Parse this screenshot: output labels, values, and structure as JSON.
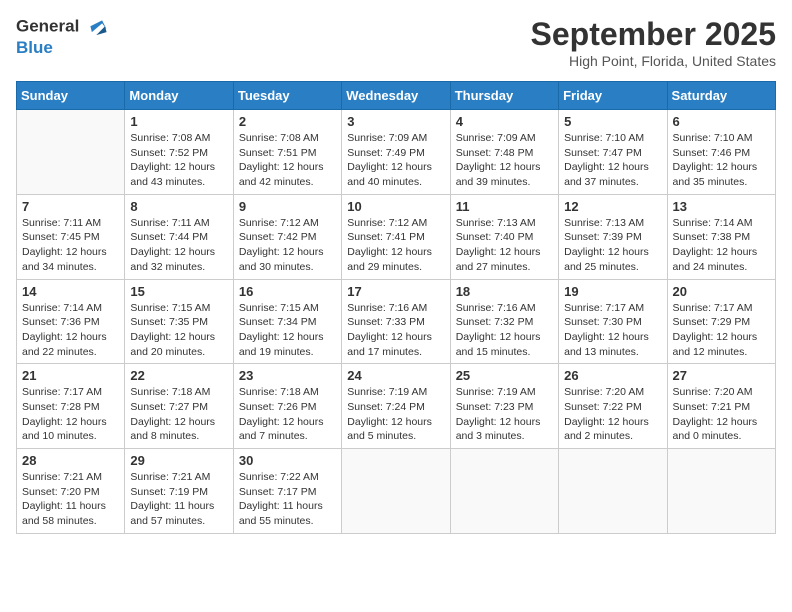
{
  "logo": {
    "line1": "General",
    "line2": "Blue"
  },
  "title": "September 2025",
  "subtitle": "High Point, Florida, United States",
  "days_of_week": [
    "Sunday",
    "Monday",
    "Tuesday",
    "Wednesday",
    "Thursday",
    "Friday",
    "Saturday"
  ],
  "weeks": [
    [
      {
        "day": "",
        "text": ""
      },
      {
        "day": "1",
        "text": "Sunrise: 7:08 AM\nSunset: 7:52 PM\nDaylight: 12 hours and 43 minutes."
      },
      {
        "day": "2",
        "text": "Sunrise: 7:08 AM\nSunset: 7:51 PM\nDaylight: 12 hours and 42 minutes."
      },
      {
        "day": "3",
        "text": "Sunrise: 7:09 AM\nSunset: 7:49 PM\nDaylight: 12 hours and 40 minutes."
      },
      {
        "day": "4",
        "text": "Sunrise: 7:09 AM\nSunset: 7:48 PM\nDaylight: 12 hours and 39 minutes."
      },
      {
        "day": "5",
        "text": "Sunrise: 7:10 AM\nSunset: 7:47 PM\nDaylight: 12 hours and 37 minutes."
      },
      {
        "day": "6",
        "text": "Sunrise: 7:10 AM\nSunset: 7:46 PM\nDaylight: 12 hours and 35 minutes."
      }
    ],
    [
      {
        "day": "7",
        "text": "Sunrise: 7:11 AM\nSunset: 7:45 PM\nDaylight: 12 hours and 34 minutes."
      },
      {
        "day": "8",
        "text": "Sunrise: 7:11 AM\nSunset: 7:44 PM\nDaylight: 12 hours and 32 minutes."
      },
      {
        "day": "9",
        "text": "Sunrise: 7:12 AM\nSunset: 7:42 PM\nDaylight: 12 hours and 30 minutes."
      },
      {
        "day": "10",
        "text": "Sunrise: 7:12 AM\nSunset: 7:41 PM\nDaylight: 12 hours and 29 minutes."
      },
      {
        "day": "11",
        "text": "Sunrise: 7:13 AM\nSunset: 7:40 PM\nDaylight: 12 hours and 27 minutes."
      },
      {
        "day": "12",
        "text": "Sunrise: 7:13 AM\nSunset: 7:39 PM\nDaylight: 12 hours and 25 minutes."
      },
      {
        "day": "13",
        "text": "Sunrise: 7:14 AM\nSunset: 7:38 PM\nDaylight: 12 hours and 24 minutes."
      }
    ],
    [
      {
        "day": "14",
        "text": "Sunrise: 7:14 AM\nSunset: 7:36 PM\nDaylight: 12 hours and 22 minutes."
      },
      {
        "day": "15",
        "text": "Sunrise: 7:15 AM\nSunset: 7:35 PM\nDaylight: 12 hours and 20 minutes."
      },
      {
        "day": "16",
        "text": "Sunrise: 7:15 AM\nSunset: 7:34 PM\nDaylight: 12 hours and 19 minutes."
      },
      {
        "day": "17",
        "text": "Sunrise: 7:16 AM\nSunset: 7:33 PM\nDaylight: 12 hours and 17 minutes."
      },
      {
        "day": "18",
        "text": "Sunrise: 7:16 AM\nSunset: 7:32 PM\nDaylight: 12 hours and 15 minutes."
      },
      {
        "day": "19",
        "text": "Sunrise: 7:17 AM\nSunset: 7:30 PM\nDaylight: 12 hours and 13 minutes."
      },
      {
        "day": "20",
        "text": "Sunrise: 7:17 AM\nSunset: 7:29 PM\nDaylight: 12 hours and 12 minutes."
      }
    ],
    [
      {
        "day": "21",
        "text": "Sunrise: 7:17 AM\nSunset: 7:28 PM\nDaylight: 12 hours and 10 minutes."
      },
      {
        "day": "22",
        "text": "Sunrise: 7:18 AM\nSunset: 7:27 PM\nDaylight: 12 hours and 8 minutes."
      },
      {
        "day": "23",
        "text": "Sunrise: 7:18 AM\nSunset: 7:26 PM\nDaylight: 12 hours and 7 minutes."
      },
      {
        "day": "24",
        "text": "Sunrise: 7:19 AM\nSunset: 7:24 PM\nDaylight: 12 hours and 5 minutes."
      },
      {
        "day": "25",
        "text": "Sunrise: 7:19 AM\nSunset: 7:23 PM\nDaylight: 12 hours and 3 minutes."
      },
      {
        "day": "26",
        "text": "Sunrise: 7:20 AM\nSunset: 7:22 PM\nDaylight: 12 hours and 2 minutes."
      },
      {
        "day": "27",
        "text": "Sunrise: 7:20 AM\nSunset: 7:21 PM\nDaylight: 12 hours and 0 minutes."
      }
    ],
    [
      {
        "day": "28",
        "text": "Sunrise: 7:21 AM\nSunset: 7:20 PM\nDaylight: 11 hours and 58 minutes."
      },
      {
        "day": "29",
        "text": "Sunrise: 7:21 AM\nSunset: 7:19 PM\nDaylight: 11 hours and 57 minutes."
      },
      {
        "day": "30",
        "text": "Sunrise: 7:22 AM\nSunset: 7:17 PM\nDaylight: 11 hours and 55 minutes."
      },
      {
        "day": "",
        "text": ""
      },
      {
        "day": "",
        "text": ""
      },
      {
        "day": "",
        "text": ""
      },
      {
        "day": "",
        "text": ""
      }
    ]
  ]
}
